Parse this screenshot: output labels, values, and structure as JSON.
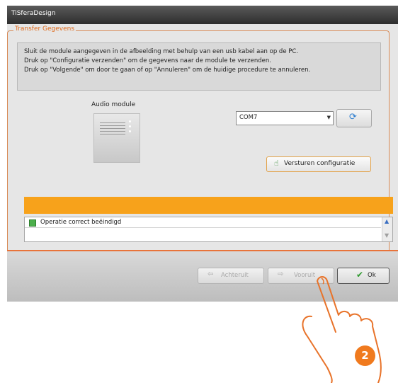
{
  "window": {
    "title": "TiSferaDesign"
  },
  "group": {
    "label": "Transfer Gegevens"
  },
  "instructions": [
    "Sluit de module aangegeven in de afbeelding met behulp van een usb kabel aan op de PC.",
    "Druk op \"Configuratie verzenden\" om de gegevens naar de module te verzenden.",
    "Druk op \"Volgende\" om door te gaan of op \"Annuleren\" om de huidige procedure te annuleren."
  ],
  "module": {
    "title": "Audio module"
  },
  "port": {
    "selected": "COM7"
  },
  "send_button": {
    "label": "Versturen configuratie"
  },
  "progress": {
    "value": 1.0,
    "color": "#f7a21b"
  },
  "status": {
    "message": "Operatie correct beëindigd",
    "indicator_color": "#4caf4c"
  },
  "footer": {
    "back_label": "Achteruit",
    "next_label": "Vooruit",
    "ok_label": "Ok"
  },
  "badge": {
    "number": "2"
  },
  "icons": {
    "refresh": "refresh-icon",
    "send": "hand-point-icon",
    "back": "arrow-left-icon",
    "next": "arrow-right-icon",
    "ok": "checkmark-icon"
  },
  "colors": {
    "accent": "#f07a1e",
    "titlebar": "#3c3c3c"
  }
}
